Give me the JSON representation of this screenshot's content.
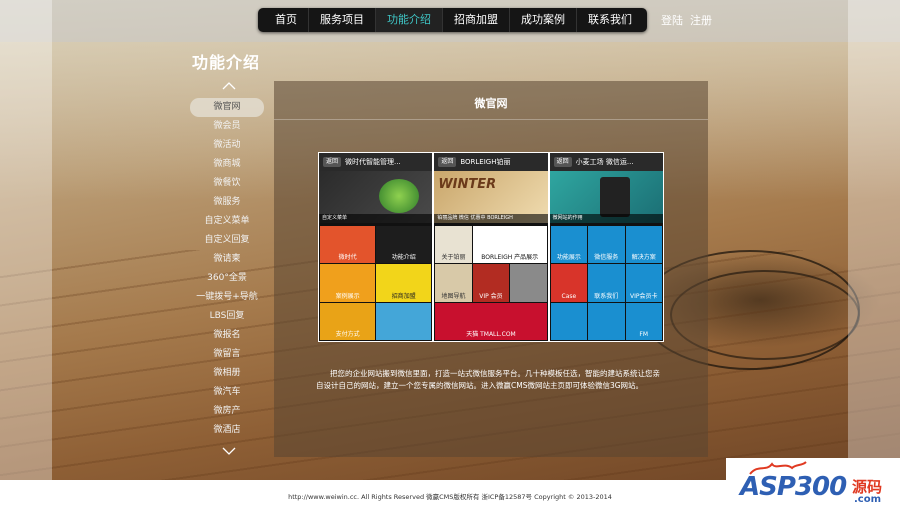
{
  "nav": {
    "items": [
      "首页",
      "服务项目",
      "功能介绍",
      "招商加盟",
      "成功案例",
      "联系我们"
    ],
    "active_index": 2
  },
  "auth": {
    "login": "登陆",
    "register": "注册"
  },
  "page_title": "功能介绍",
  "sidebar": {
    "items": [
      "微官网",
      "微会员",
      "微活动",
      "微商城",
      "微餐饮",
      "微服务",
      "自定义菜单",
      "自定义回复",
      "微请柬",
      "360°全景",
      "一键拨号+导航",
      "LBS回复",
      "微报名",
      "微留言",
      "微相册",
      "微汽车",
      "微房产",
      "微酒店"
    ],
    "active_index": 0
  },
  "panel": {
    "title": "微官网",
    "description": "把您的企业网站搬到微信里面，打造一站式微信服务平台。几十种模板任选，智能的建站系统让您亲自设计自己的网站，建立一个您专属的微信网站。进入微赢CMS微网站主页即可体验微信3G网站。"
  },
  "phones": [
    {
      "header": "微时代智能管理...",
      "back": "返回",
      "caption": "自定义菜单",
      "tiles": [
        "微时代",
        "功能介绍",
        "案例展示",
        "招商加盟",
        "支付方式",
        ""
      ]
    },
    {
      "header": "BORLEIGH铂丽",
      "back": "返回",
      "caption": "铂丽品牌 微信 优惠中 BORLEIGH",
      "tiles": [
        "关于铂丽",
        "BORLEIGH 产品展示",
        "地图导航",
        "VIP 会员",
        "",
        "天猫 TMALL.COM"
      ]
    },
    {
      "header": "小麦工场 微信运...",
      "back": "返回",
      "caption": "微网站的作用",
      "tiles": [
        "功能展示",
        "微信服务",
        "解决方案",
        "Case",
        "联系我们",
        "VIP会员卡",
        "",
        "",
        "FM"
      ]
    }
  ],
  "colors": {
    "accent": "#3fc7c7",
    "nav_bg": "#151515",
    "logo_blue": "#2e5fb3",
    "logo_red": "#e03a22"
  },
  "footer": {
    "text": "http://www.weiwin.cc. All Rights Reserved 微赢CMS版权所有 浙ICP备12587号 Copyright © 2013-2014"
  },
  "logo": {
    "brand": "ASP300",
    "cn": "源码",
    "domain": ".com"
  }
}
